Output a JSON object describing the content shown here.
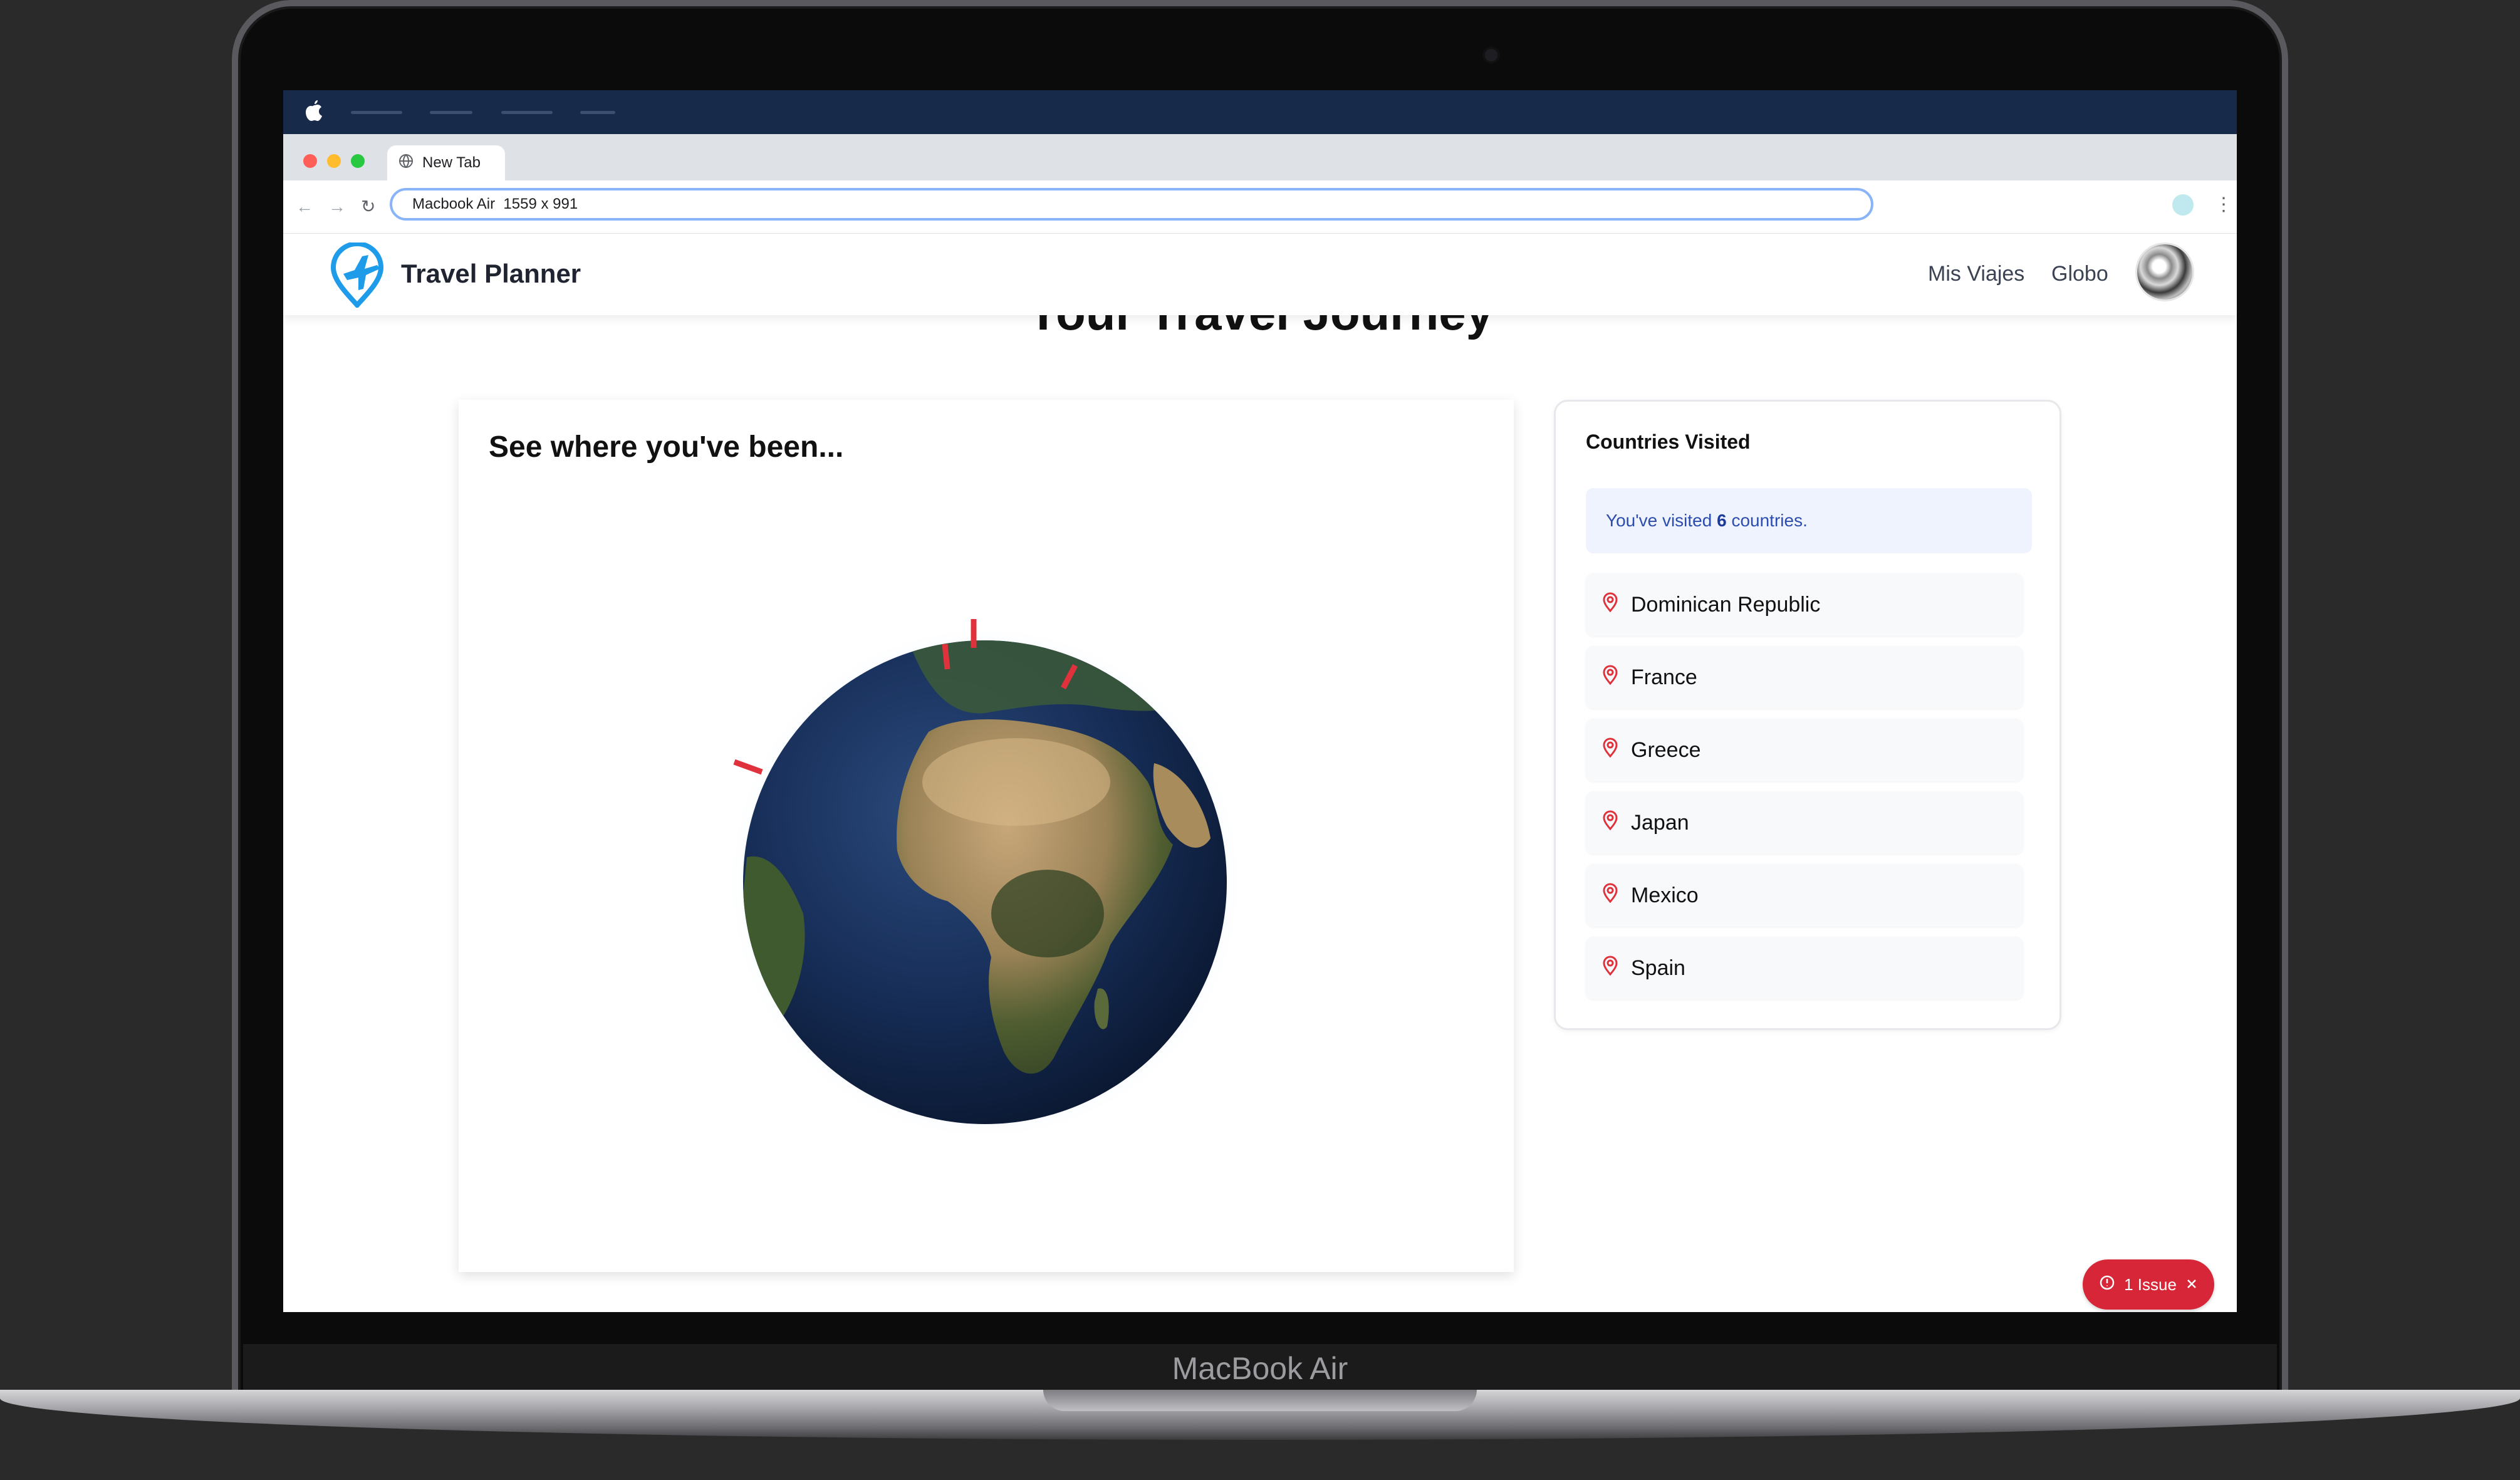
{
  "device": {
    "brand_label": "MacBook Air"
  },
  "browser": {
    "tab_title": "New Tab",
    "address_text": "Macbook Air  1559 x 991"
  },
  "app": {
    "title": "Travel Planner",
    "nav": [
      {
        "label": "Mis Viajes"
      },
      {
        "label": "Globo"
      }
    ]
  },
  "page": {
    "heading": "Your Travel Journey",
    "globe_card_title": "See where you've been...",
    "countries_card": {
      "title": "Countries Visited",
      "visited_prefix": "You've visited ",
      "visited_count": "6",
      "visited_suffix": " countries.",
      "countries": [
        {
          "name": "Dominican Republic"
        },
        {
          "name": "France"
        },
        {
          "name": "Greece"
        },
        {
          "name": "Japan"
        },
        {
          "name": "Mexico"
        },
        {
          "name": "Spain"
        }
      ]
    }
  },
  "issue_badge": {
    "label": "1 Issue"
  },
  "icons": {
    "logo": "plane-pin-icon",
    "tab": "globe-icon",
    "country_marker": "map-pin-icon",
    "issue": "alert-circle-icon",
    "close": "close-icon"
  },
  "colors": {
    "accent_blue": "#1e9be9",
    "pin_red": "#e0323c",
    "issue_red": "#d72638",
    "menubar": "#172a49"
  }
}
